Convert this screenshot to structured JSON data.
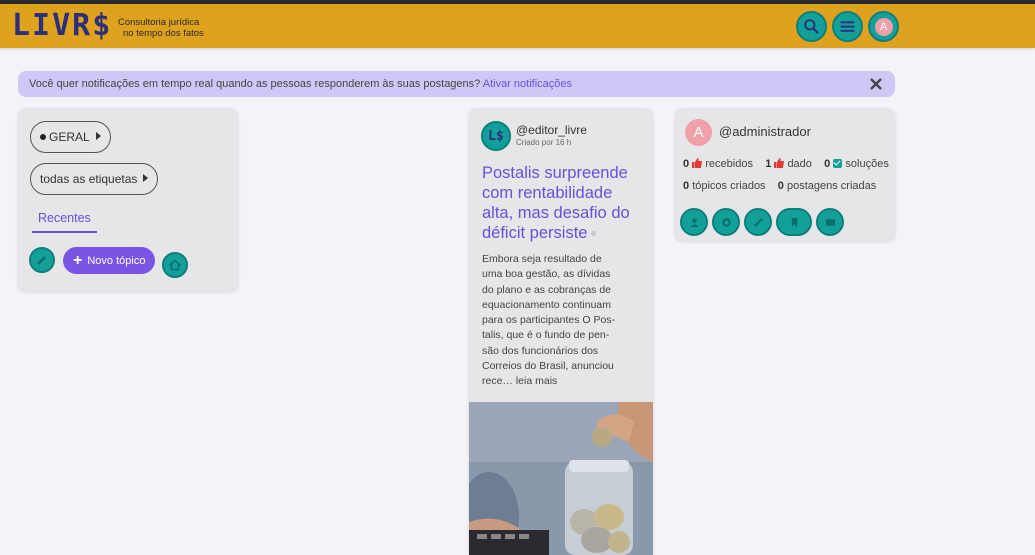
{
  "header": {
    "logo": "LIVR$",
    "tagline_line1": "Consultoria jurídica",
    "tagline_line2": "no tempo dos fatos",
    "avatar_letter": "A",
    "colors": {
      "bar": "#dea21e",
      "button": "#14a09a"
    },
    "icons": [
      "search-icon",
      "menu-icon",
      "avatar"
    ]
  },
  "notice": {
    "text": "Você quer notificações em tempo real quando as pessoas responderem às suas postagens?",
    "link": "Ativar notificações"
  },
  "filters": {
    "category": "GERAL",
    "tags": "todas as etiquetas",
    "tab": "Recentes",
    "new_topic": "Novo tópico"
  },
  "post": {
    "avatar": "L$",
    "username": "@editor_livre",
    "meta": "Criado por 16 h",
    "title": "Postalis surpreende com rentabilidade alta, mas desafio do déficit persiste",
    "excerpt_lines": [
      "Embora seja resultado de",
      "uma boa gestão, as dívidas",
      "do plano e as cobranças de",
      "equacionamento continuam",
      "para os participantes O Pos-",
      "talis, que é o fundo de pen-",
      "são dos funcionários dos",
      "Correios do Brasil, anunciou",
      "rece… leia mais"
    ]
  },
  "profile": {
    "avatar_letter": "A",
    "username": "@administrador",
    "received_count": "0",
    "received_label": "recebidos",
    "given_count": "1",
    "given_label": "dado",
    "solutions_count": "0",
    "solutions_label": "soluções",
    "topics_count": "0",
    "topics_label": "tópicos criados",
    "posts_count": "0",
    "posts_label": "postagens criadas"
  }
}
